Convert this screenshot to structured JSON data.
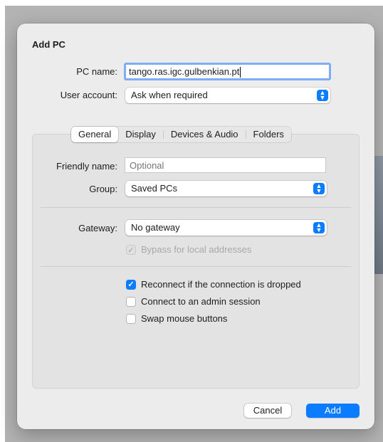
{
  "dialog": {
    "title": "Add PC",
    "pc_name": {
      "label": "PC name:",
      "value": "tango.ras.igc.gulbenkian.pt"
    },
    "user_account": {
      "label": "User account:",
      "value": "Ask when required"
    },
    "tabs": [
      {
        "label": "General",
        "active": true
      },
      {
        "label": "Display",
        "active": false
      },
      {
        "label": "Devices & Audio",
        "active": false
      },
      {
        "label": "Folders",
        "active": false
      }
    ],
    "general": {
      "friendly_name": {
        "label": "Friendly name:",
        "placeholder": "Optional"
      },
      "group": {
        "label": "Group:",
        "value": "Saved PCs"
      },
      "gateway": {
        "label": "Gateway:",
        "value": "No gateway"
      },
      "bypass": {
        "label": "Bypass for local addresses",
        "checked": true,
        "enabled": false
      },
      "options": [
        {
          "label": "Reconnect if the connection is dropped",
          "checked": true
        },
        {
          "label": "Connect to an admin session",
          "checked": false
        },
        {
          "label": "Swap mouse buttons",
          "checked": false
        }
      ]
    },
    "buttons": {
      "cancel": "Cancel",
      "add": "Add"
    }
  },
  "icons": {
    "checkmark": "checkmark-icon",
    "popup_arrows": "up-down-chevron-icon"
  },
  "colors": {
    "accent": "#0a7cff",
    "focus_ring": "#7fadf5",
    "dialog_bg": "#ececec"
  }
}
